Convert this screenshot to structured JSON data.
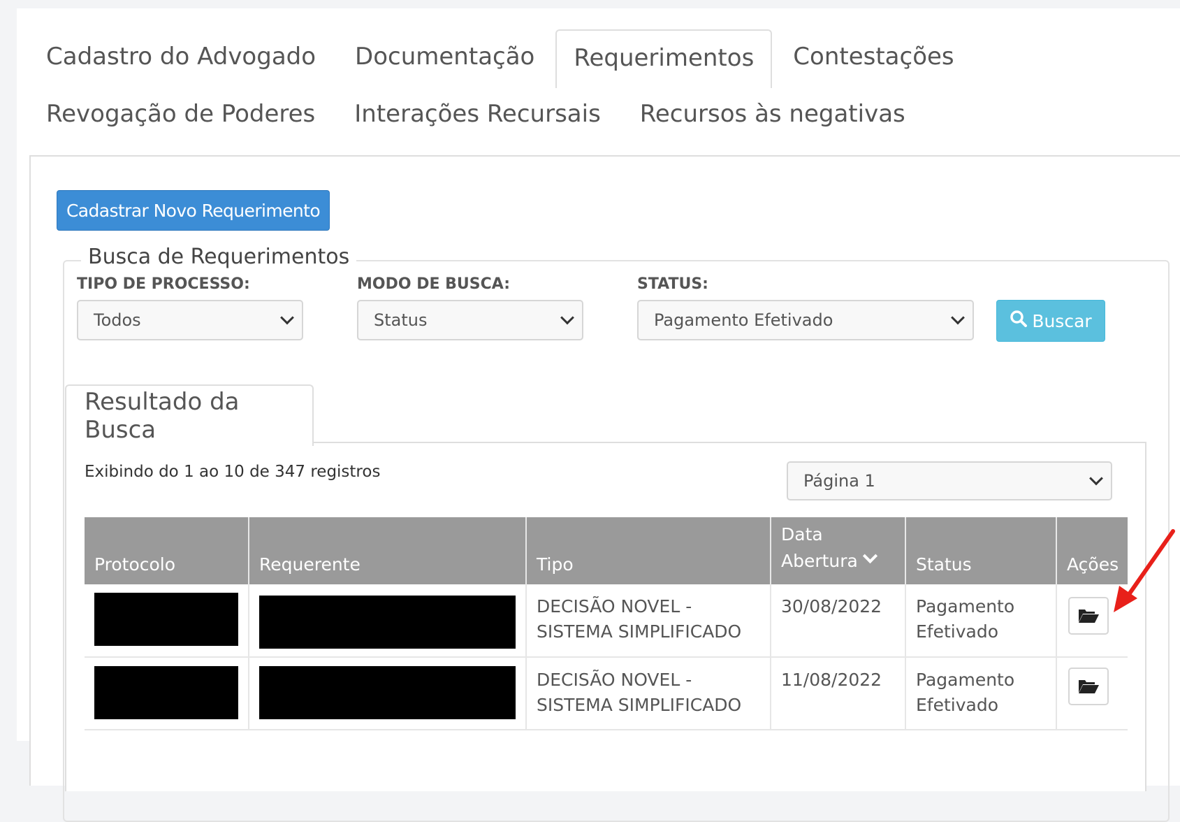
{
  "tabs": {
    "row1": [
      "Cadastro do Advogado",
      "Documentação",
      "Requerimentos",
      "Contestações"
    ],
    "row2": [
      "Revogação de Poderes",
      "Interações Recursais",
      "Recursos às negativas"
    ],
    "active": "Requerimentos"
  },
  "new_request_button": "Cadastrar Novo Requerimento",
  "search": {
    "legend": "Busca de Requerimentos",
    "tipo_label": "TIPO DE PROCESSO:",
    "tipo_value": "Todos",
    "modo_label": "MODO DE BUSCA:",
    "modo_value": "Status",
    "status_label": "STATUS:",
    "status_value": "Pagamento Efetivado",
    "button": "Buscar",
    "button_icon": "search-icon"
  },
  "results": {
    "tab": "Resultado da Busca",
    "count_text": "Exibindo do 1 ao 10 de 347 registros",
    "page_select": "Página 1",
    "columns": [
      "Protocolo",
      "Requerente",
      "Tipo",
      "Data",
      "Abertura",
      "Status",
      "Ações"
    ],
    "rows": [
      {
        "tipo_line1": "DECISÃO NOVEL -",
        "tipo_line2": "SISTEMA SIMPLIFICADO",
        "data": "30/08/2022",
        "status_line1": "Pagamento",
        "status_line2": "Efetivado"
      },
      {
        "tipo_line1": "DECISÃO NOVEL -",
        "tipo_line2": "SISTEMA SIMPLIFICADO",
        "data": "11/08/2022",
        "status_line1": "Pagamento",
        "status_line2": "Efetivado"
      }
    ]
  },
  "colors": {
    "primary_button": "#3c8dd6",
    "search_button": "#5bc0de",
    "table_header": "#9a9a9a",
    "annotation_arrow": "#e8201a"
  }
}
